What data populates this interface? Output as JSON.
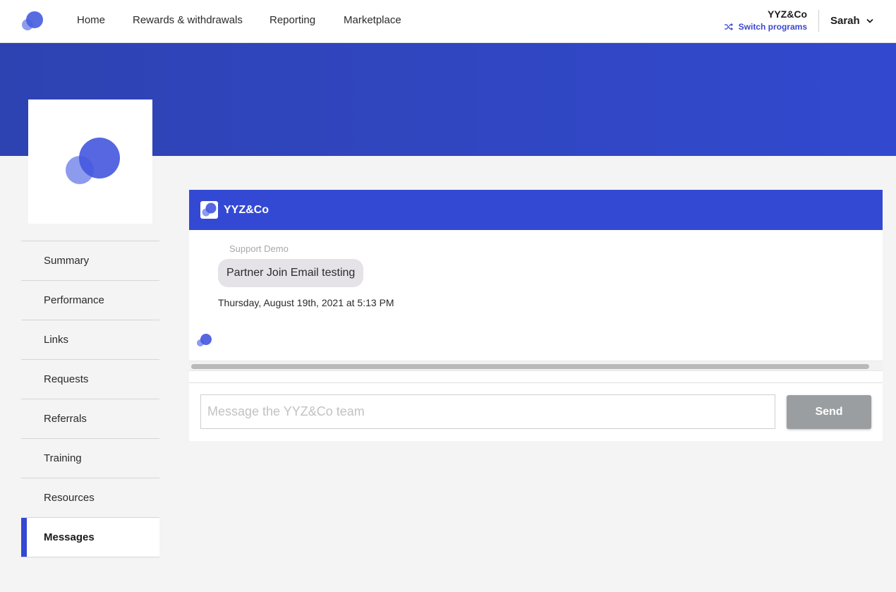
{
  "nav": {
    "links": [
      "Home",
      "Rewards & withdrawals",
      "Reporting",
      "Marketplace"
    ],
    "program_name": "YYZ&Co",
    "switch_label": "Switch programs",
    "user_name": "Sarah"
  },
  "sidebar": {
    "items": [
      {
        "label": "Summary"
      },
      {
        "label": "Performance"
      },
      {
        "label": "Links"
      },
      {
        "label": "Requests"
      },
      {
        "label": "Referrals"
      },
      {
        "label": "Training"
      },
      {
        "label": "Resources"
      },
      {
        "label": "Messages",
        "active": true
      }
    ]
  },
  "chat": {
    "title": "YYZ&Co",
    "messages": [
      {
        "sender": "Support Demo",
        "text": "Partner Join Email testing",
        "timestamp": "Thursday, August 19th, 2021 at 5:13 PM"
      }
    ],
    "input_placeholder": "Message the YYZ&Co team",
    "send_label": "Send"
  },
  "colors": {
    "brand": "#3449d3",
    "banner_start": "#2e43b2",
    "banner_end": "#3249cf",
    "link_accent": "#3b48cf",
    "send_disabled": "#9b9ea1",
    "bubble": "#e5e3e8"
  },
  "icons": {
    "logo": "brand-bubbles-icon",
    "switch": "shuffle-icon",
    "user_menu": "chevron-down-icon"
  }
}
